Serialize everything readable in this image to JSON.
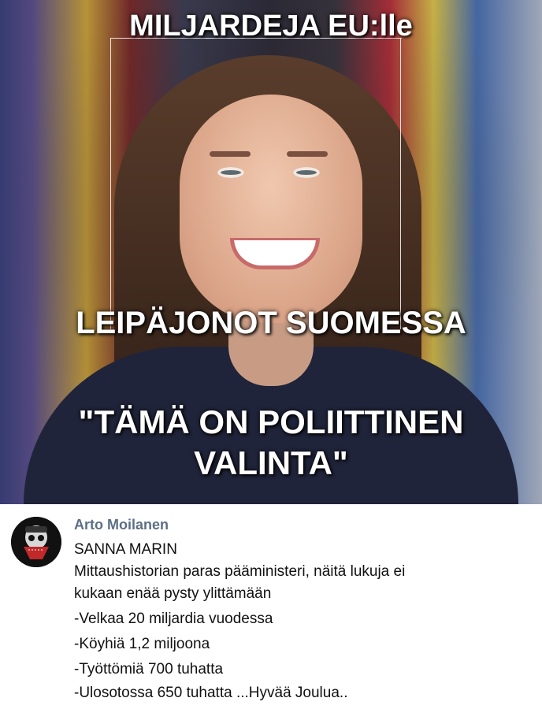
{
  "meme": {
    "caption_top": "MILJARDEJA EU:lle",
    "caption_middle": "LEIPÄJONOT SUOMESSA",
    "caption_quote_1": "\"TÄMÄ ON POLIITTINEN",
    "caption_quote_2": "VALINTA\""
  },
  "post": {
    "author": "Arto Moilanen",
    "lines": [
      "SANNA MARIN",
      "Mittaushistorian paras pääministeri, näitä lukuja ei",
      "kukaan enää pysty ylittämään",
      "-Velkaa 20 miljardia vuodessa",
      "-Köyhiä 1,2 miljoona",
      "-Työttömiä 700 tuhatta",
      "-Ulosotossa 650 tuhatta ...Hyvää Joulua.."
    ]
  },
  "colors": {
    "author": "#5b6f86",
    "text": "#111111",
    "caption": "#ffffff"
  }
}
